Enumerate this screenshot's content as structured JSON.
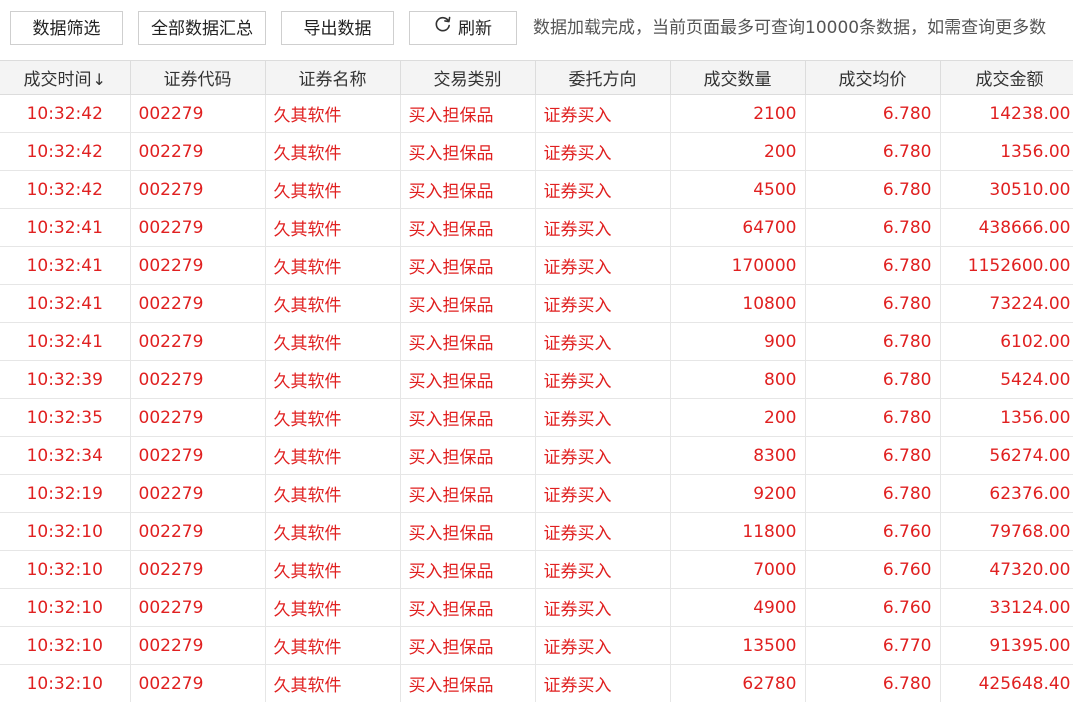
{
  "toolbar": {
    "filter_label": "数据筛选",
    "summary_label": "全部数据汇总",
    "export_label": "导出数据",
    "refresh_label": "刷新",
    "status": "数据加载完成，当前页面最多可查询10000条数据，如需查询更多数"
  },
  "table": {
    "headers": [
      "成交时间",
      "证券代码",
      "证券名称",
      "交易类别",
      "委托方向",
      "成交数量",
      "成交均价",
      "成交金额"
    ],
    "sort_arrow": "↓",
    "rows": [
      [
        "10:32:42",
        "002279",
        "久其软件",
        "买入担保品",
        "证券买入",
        "2100",
        "6.780",
        "14238.00"
      ],
      [
        "10:32:42",
        "002279",
        "久其软件",
        "买入担保品",
        "证券买入",
        "200",
        "6.780",
        "1356.00"
      ],
      [
        "10:32:42",
        "002279",
        "久其软件",
        "买入担保品",
        "证券买入",
        "4500",
        "6.780",
        "30510.00"
      ],
      [
        "10:32:41",
        "002279",
        "久其软件",
        "买入担保品",
        "证券买入",
        "64700",
        "6.780",
        "438666.00"
      ],
      [
        "10:32:41",
        "002279",
        "久其软件",
        "买入担保品",
        "证券买入",
        "170000",
        "6.780",
        "1152600.00"
      ],
      [
        "10:32:41",
        "002279",
        "久其软件",
        "买入担保品",
        "证券买入",
        "10800",
        "6.780",
        "73224.00"
      ],
      [
        "10:32:41",
        "002279",
        "久其软件",
        "买入担保品",
        "证券买入",
        "900",
        "6.780",
        "6102.00"
      ],
      [
        "10:32:39",
        "002279",
        "久其软件",
        "买入担保品",
        "证券买入",
        "800",
        "6.780",
        "5424.00"
      ],
      [
        "10:32:35",
        "002279",
        "久其软件",
        "买入担保品",
        "证券买入",
        "200",
        "6.780",
        "1356.00"
      ],
      [
        "10:32:34",
        "002279",
        "久其软件",
        "买入担保品",
        "证券买入",
        "8300",
        "6.780",
        "56274.00"
      ],
      [
        "10:32:19",
        "002279",
        "久其软件",
        "买入担保品",
        "证券买入",
        "9200",
        "6.780",
        "62376.00"
      ],
      [
        "10:32:10",
        "002279",
        "久其软件",
        "买入担保品",
        "证券买入",
        "11800",
        "6.760",
        "79768.00"
      ],
      [
        "10:32:10",
        "002279",
        "久其软件",
        "买入担保品",
        "证券买入",
        "7000",
        "6.760",
        "47320.00"
      ],
      [
        "10:32:10",
        "002279",
        "久其软件",
        "买入担保品",
        "证券买入",
        "4900",
        "6.760",
        "33124.00"
      ],
      [
        "10:32:10",
        "002279",
        "久其软件",
        "买入担保品",
        "证券买入",
        "13500",
        "6.770",
        "91395.00"
      ],
      [
        "10:32:10",
        "002279",
        "久其软件",
        "买入担保品",
        "证券买入",
        "62780",
        "6.780",
        "425648.40"
      ]
    ]
  },
  "colors": {
    "row_text": "#e02020",
    "header_bg": "#f4f4f4",
    "border": "#dcdcdc"
  },
  "icons": {
    "refresh": "refresh-icon"
  }
}
